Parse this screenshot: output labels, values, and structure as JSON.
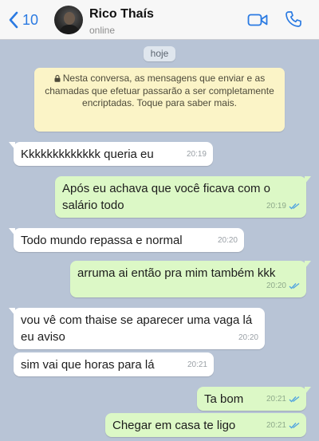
{
  "header": {
    "back_count": "10",
    "contact_name": "Rico Thaís",
    "status": "online"
  },
  "chat": {
    "date_label": "hoje",
    "encryption_notice": "Nesta conversa, as mensagens que enviar e as chamadas que efetuar passarão a ser completamente encriptadas. Toque para saber mais.",
    "messages": [
      {
        "direction": "in",
        "text": "Kkkkkkkkkkkkk queria eu",
        "time": "20:19"
      },
      {
        "direction": "out",
        "text": "Após eu achava que você ficava com o salário todo",
        "time": "20:19",
        "read": true
      },
      {
        "direction": "in",
        "text": "Todo mundo repassa e normal",
        "time": "20:20"
      },
      {
        "direction": "out",
        "text": "arruma ai então pra mim também kkk",
        "time": "20:20",
        "read": true
      },
      {
        "direction": "in",
        "text": "vou vê com thaise se aparecer uma vaga lá eu aviso",
        "time": "20:20"
      },
      {
        "direction": "in",
        "text": "sim vai que horas para lá",
        "time": "20:21"
      },
      {
        "direction": "out",
        "text": "Ta bom",
        "time": "20:21",
        "read": true
      },
      {
        "direction": "out",
        "text": "Chegar em casa te ligo",
        "time": "20:21",
        "read": true
      }
    ]
  },
  "colors": {
    "chat_background": "#b8c4d6",
    "incoming_bubble": "#ffffff",
    "outgoing_bubble": "#dcf8c6",
    "notice_background": "#fbf4c7",
    "accent": "#2a7ae2",
    "read_ticks": "#4fa3e0"
  },
  "icons": {
    "back": "chevron-left-icon",
    "video": "video-camera-icon",
    "call": "phone-icon",
    "lock": "lock-icon",
    "read": "double-check-icon"
  }
}
